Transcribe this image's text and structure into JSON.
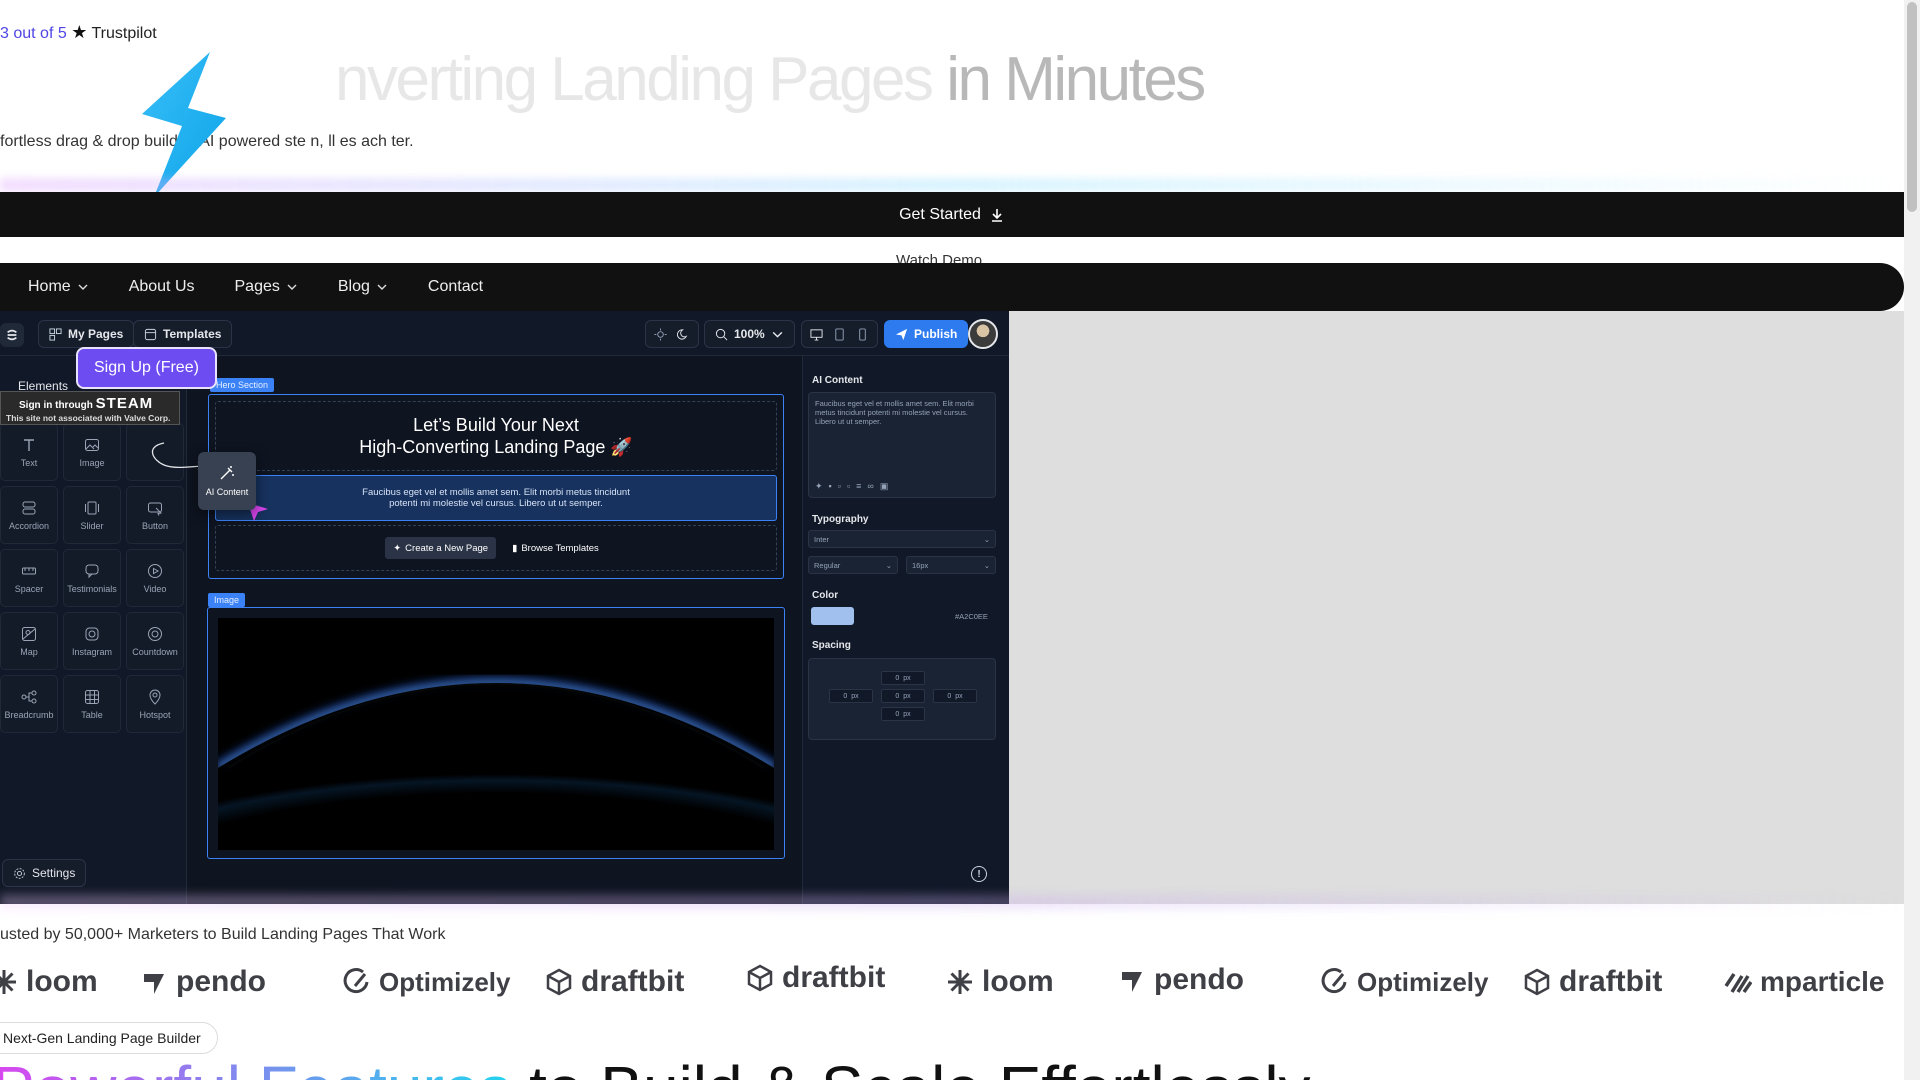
{
  "trustpilot": {
    "score": "3",
    "out_of": "out of 5",
    "star": "★",
    "brand": "Trustpilot"
  },
  "hero": {
    "title_dim": "nverting Landing Pages",
    "title_main": " in Minutes",
    "subtitle": "fortless drag & drop builder, AI powered   ste  n,    ll    es    ach    ter."
  },
  "cta": {
    "get_started": "Get Started",
    "watch_demo": "Watch Demo"
  },
  "nav": {
    "items": [
      {
        "label": "Home",
        "has_menu": true
      },
      {
        "label": "About Us",
        "has_menu": false
      },
      {
        "label": "Pages",
        "has_menu": true
      },
      {
        "label": "Blog",
        "has_menu": true
      },
      {
        "label": "Contact",
        "has_menu": false
      }
    ]
  },
  "editor": {
    "my_pages": "My Pages",
    "templates": "Templates",
    "zoom": "100%",
    "publish": "Publish",
    "elements_label": "Elements",
    "settings": "Settings",
    "elements": [
      {
        "label": "Text",
        "icon": "text-icon"
      },
      {
        "label": "Image",
        "icon": "image-icon"
      },
      {
        "label": "",
        "icon": ""
      },
      {
        "label": "Accordion",
        "icon": "accordion-icon"
      },
      {
        "label": "Slider",
        "icon": "slider-icon"
      },
      {
        "label": "Button",
        "icon": "button-icon"
      },
      {
        "label": "Spacer",
        "icon": "spacer-icon"
      },
      {
        "label": "Testimonials",
        "icon": "testimonials-icon"
      },
      {
        "label": "Video",
        "icon": "video-icon"
      },
      {
        "label": "Map",
        "icon": "map-icon"
      },
      {
        "label": "Instagram",
        "icon": "instagram-icon"
      },
      {
        "label": "Countdown",
        "icon": "countdown-icon"
      },
      {
        "label": "Breadcrumb",
        "icon": "breadcrumb-icon"
      },
      {
        "label": "Table",
        "icon": "table-icon"
      },
      {
        "label": "Hotspot",
        "icon": "hotspot-icon"
      }
    ],
    "hero_tag": "Hero Section",
    "hero_line1": "Let’s Build Your Next",
    "hero_line2": "High-Converting Landing Page 🚀",
    "hero_body1": "Faucibus eget vel et mollis amet sem. Elit morbi metus tincidunt",
    "hero_body2": "potenti mi molestie vel cursus. Libero ut ut semper.",
    "create_page": "Create a New Page",
    "browse_templates": "Browse Templates",
    "ai_card": "AI Content",
    "image_tag": "Image",
    "panel": {
      "ai_title": "AI Content",
      "ai_text": "Faucibus eget vel et mollis amet sem. Elit morbi metus tincidunt potenti mi molestie vel cursus. Libero ut ut semper.",
      "typography": "Typography",
      "font": "Inter",
      "weight": "Regular",
      "size": "16px",
      "color_label": "Color",
      "color_hex": "#A2C0EE",
      "spacing_label": "Spacing",
      "spacing_value": "0",
      "spacing_unit": "px"
    }
  },
  "overlay": {
    "signup": "Sign Up (Free)",
    "steam_line1": "Sign in through",
    "steam_brand": "STEAM",
    "steam_line2": "This site not associated with Valve Corp."
  },
  "trusted": "usted by 50,000+ Marketers to Build Landing Pages That Work",
  "logos": [
    "loom",
    "pendo",
    "Optimizely",
    "draftbit",
    "draftbit",
    "loom",
    "pendo",
    "Optimizely",
    "draftbit",
    "mparticle"
  ],
  "nextgen_badge": "Next-Gen Landing Page Builder",
  "features": {
    "highlight": "Powerful Features",
    "rest": " to Build & Scale Effortlessly"
  },
  "colors": {
    "accent_purple": "#6d4df2",
    "publish_blue": "#2e7bf0",
    "editor_bg": "#0e1420",
    "nav_bg": "#111111"
  }
}
